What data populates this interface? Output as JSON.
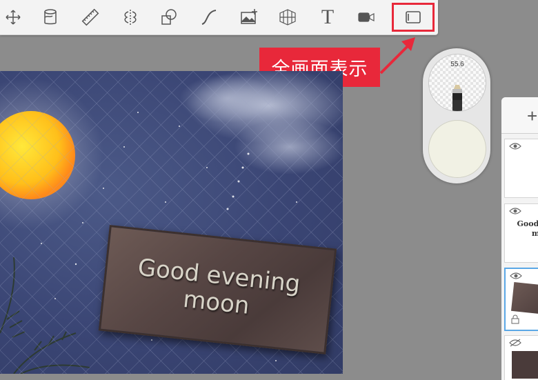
{
  "toolbar": {
    "tools": [
      {
        "name": "move-tool",
        "icon": "move-arrows-icon"
      },
      {
        "name": "fill-tool",
        "icon": "bucket-icon"
      },
      {
        "name": "ruler-tool",
        "icon": "ruler-icon"
      },
      {
        "name": "symmetry-tool",
        "icon": "symmetry-icon"
      },
      {
        "name": "shape-tool",
        "icon": "shape-icon"
      },
      {
        "name": "curve-tool",
        "icon": "curve-icon"
      },
      {
        "name": "add-image-tool",
        "icon": "add-image-icon"
      },
      {
        "name": "perspective-tool",
        "icon": "perspective-grid-icon"
      },
      {
        "name": "text-tool",
        "icon": "text-icon",
        "glyph": "T"
      },
      {
        "name": "record-tool",
        "icon": "video-camera-icon"
      },
      {
        "name": "fullscreen-tool",
        "icon": "fullscreen-icon"
      }
    ]
  },
  "callout": {
    "label": "全画面表示",
    "color": "#e8283a"
  },
  "canvas": {
    "sign_line1": "Good evening",
    "sign_line2": "moon"
  },
  "color_panel": {
    "brush_size": "55.6",
    "current_color": "#f1f1e4"
  },
  "layers": {
    "add_label": "+",
    "items": [
      {
        "visible": true,
        "preview_text": ""
      },
      {
        "visible": true,
        "preview_text_line1": "Good ev",
        "preview_text_line2": "moo"
      },
      {
        "visible": true,
        "selected": true
      },
      {
        "visible": false
      }
    ]
  }
}
